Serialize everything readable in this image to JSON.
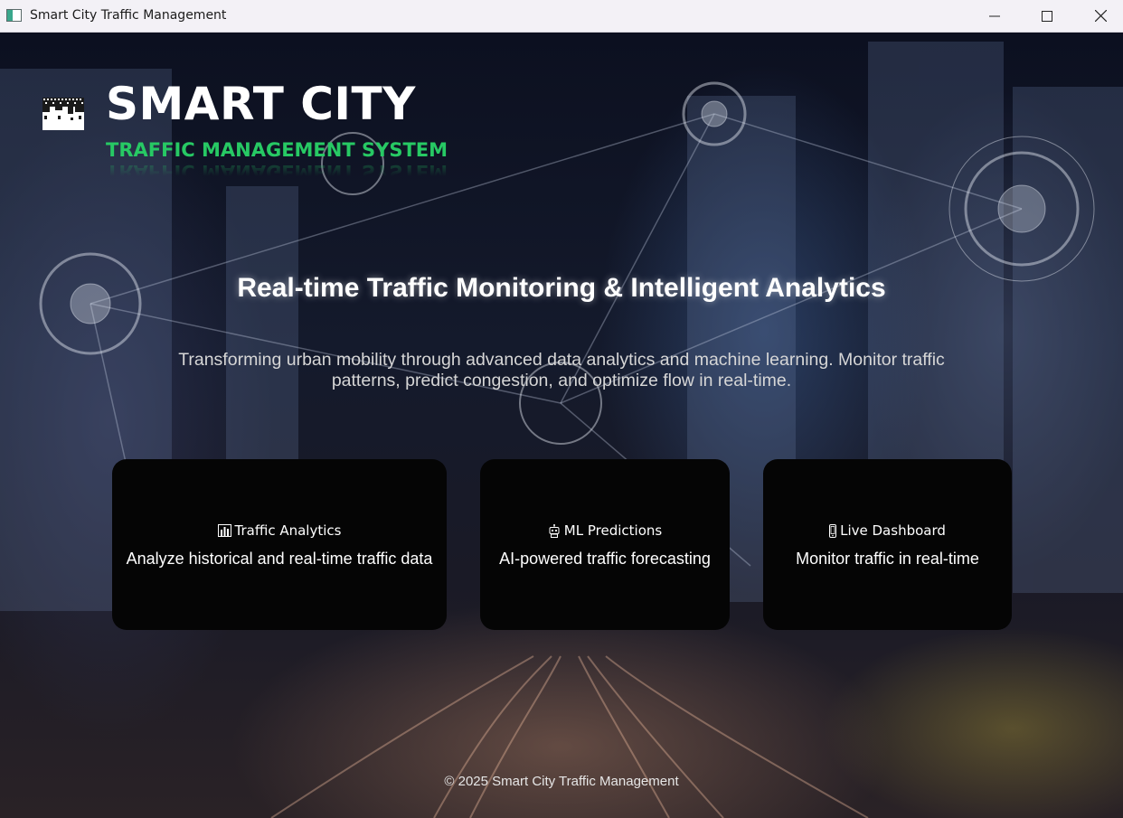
{
  "window": {
    "title": "Smart City Traffic Management",
    "controls": [
      "minimize",
      "maximize",
      "close"
    ]
  },
  "brand": {
    "title": "SMART CITY",
    "subtitle": "TRAFFIC MANAGEMENT SYSTEM",
    "logo_icon": "city-skyline-icon",
    "accent_color": "#27c964"
  },
  "hero": {
    "headline": "Real-time Traffic Monitoring & Intelligent Analytics",
    "tagline": "Transforming urban mobility through advanced data analytics and machine learning. Monitor traffic patterns, predict congestion, and optimize flow in real-time."
  },
  "cards": [
    {
      "icon": "bar-chart-icon",
      "title": "Traffic Analytics",
      "description": "Analyze historical and real-time traffic data"
    },
    {
      "icon": "robot-icon",
      "title": "ML Predictions",
      "description": "AI-powered traffic forecasting"
    },
    {
      "icon": "mobile-phone-icon",
      "title": "Live Dashboard",
      "description": "Monitor traffic in real-time"
    }
  ],
  "footer": {
    "text": "© 2025 Smart City Traffic Management"
  }
}
